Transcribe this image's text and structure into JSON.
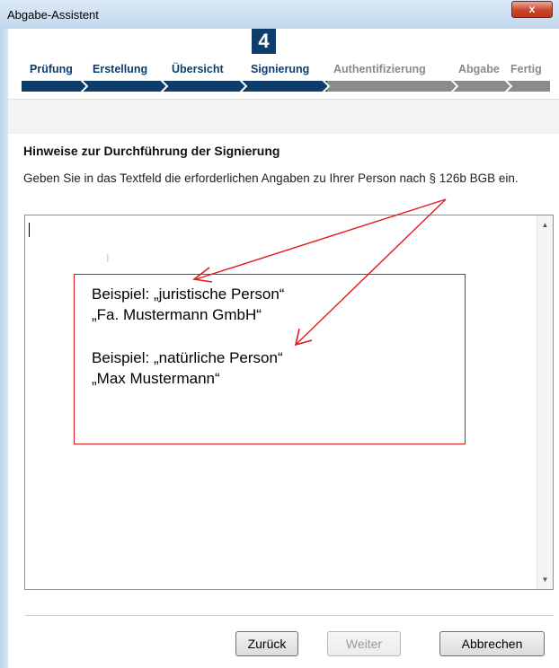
{
  "window": {
    "title": "Abgabe-Assistent",
    "close_label": "x"
  },
  "wizard": {
    "current_step_number": "4",
    "steps": [
      {
        "label": "Prüfung",
        "state": "done"
      },
      {
        "label": "Erstellung",
        "state": "done"
      },
      {
        "label": "Übersicht",
        "state": "done"
      },
      {
        "label": "Signierung",
        "state": "current"
      },
      {
        "label": "Authentifizierung",
        "state": "todo"
      },
      {
        "label": "Abgabe",
        "state": "todo"
      },
      {
        "label": "Fertig",
        "state": "todo"
      }
    ],
    "done_color": "#0f3d6b",
    "todo_color": "#8a8a8a"
  },
  "content": {
    "heading": "Hinweise zur Durchführung der Signierung",
    "instruction": "Geben Sie in das Textfeld die erforderlichen Angaben zu Ihrer Person nach § 126b BGB ein.",
    "textarea_value": ""
  },
  "annotation": {
    "color": "#e01a1a",
    "lines": [
      "Beispiel: „juristische Person“",
      "„Fa. Mustermann GmbH“",
      "Beispiel: „natürliche Person“",
      "„Max Mustermann“"
    ]
  },
  "buttons": {
    "back": "Zurück",
    "next": "Weiter",
    "cancel": "Abbrechen"
  }
}
